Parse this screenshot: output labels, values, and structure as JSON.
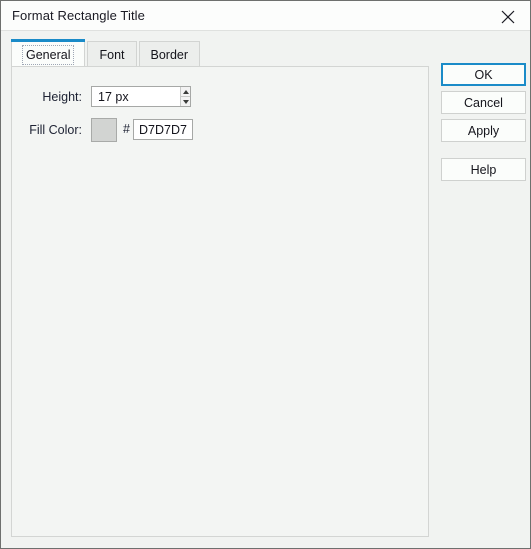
{
  "window": {
    "title": "Format Rectangle Title",
    "close_icon": "close-icon"
  },
  "tabs": [
    {
      "label": "General",
      "active": true
    },
    {
      "label": "Font",
      "active": false
    },
    {
      "label": "Border",
      "active": false
    }
  ],
  "general_tab": {
    "height_field": {
      "label": "Height:",
      "value": "17 px",
      "stepper_up_icon": "chevron-up-icon",
      "stepper_down_icon": "chevron-down-icon"
    },
    "fill_color_field": {
      "label": "Fill Color:",
      "swatch_color": "#D2D4D2",
      "hash_prefix": "#",
      "hex_value": "D7D7D7"
    }
  },
  "buttons": {
    "ok": "OK",
    "cancel": "Cancel",
    "apply": "Apply",
    "help": "Help"
  },
  "colors": {
    "accent": "#1A8BC8",
    "dialog_background": "#F1F3F1",
    "titlebar_background": "#FCFDFC",
    "panel_background": "#F3F5F3"
  }
}
